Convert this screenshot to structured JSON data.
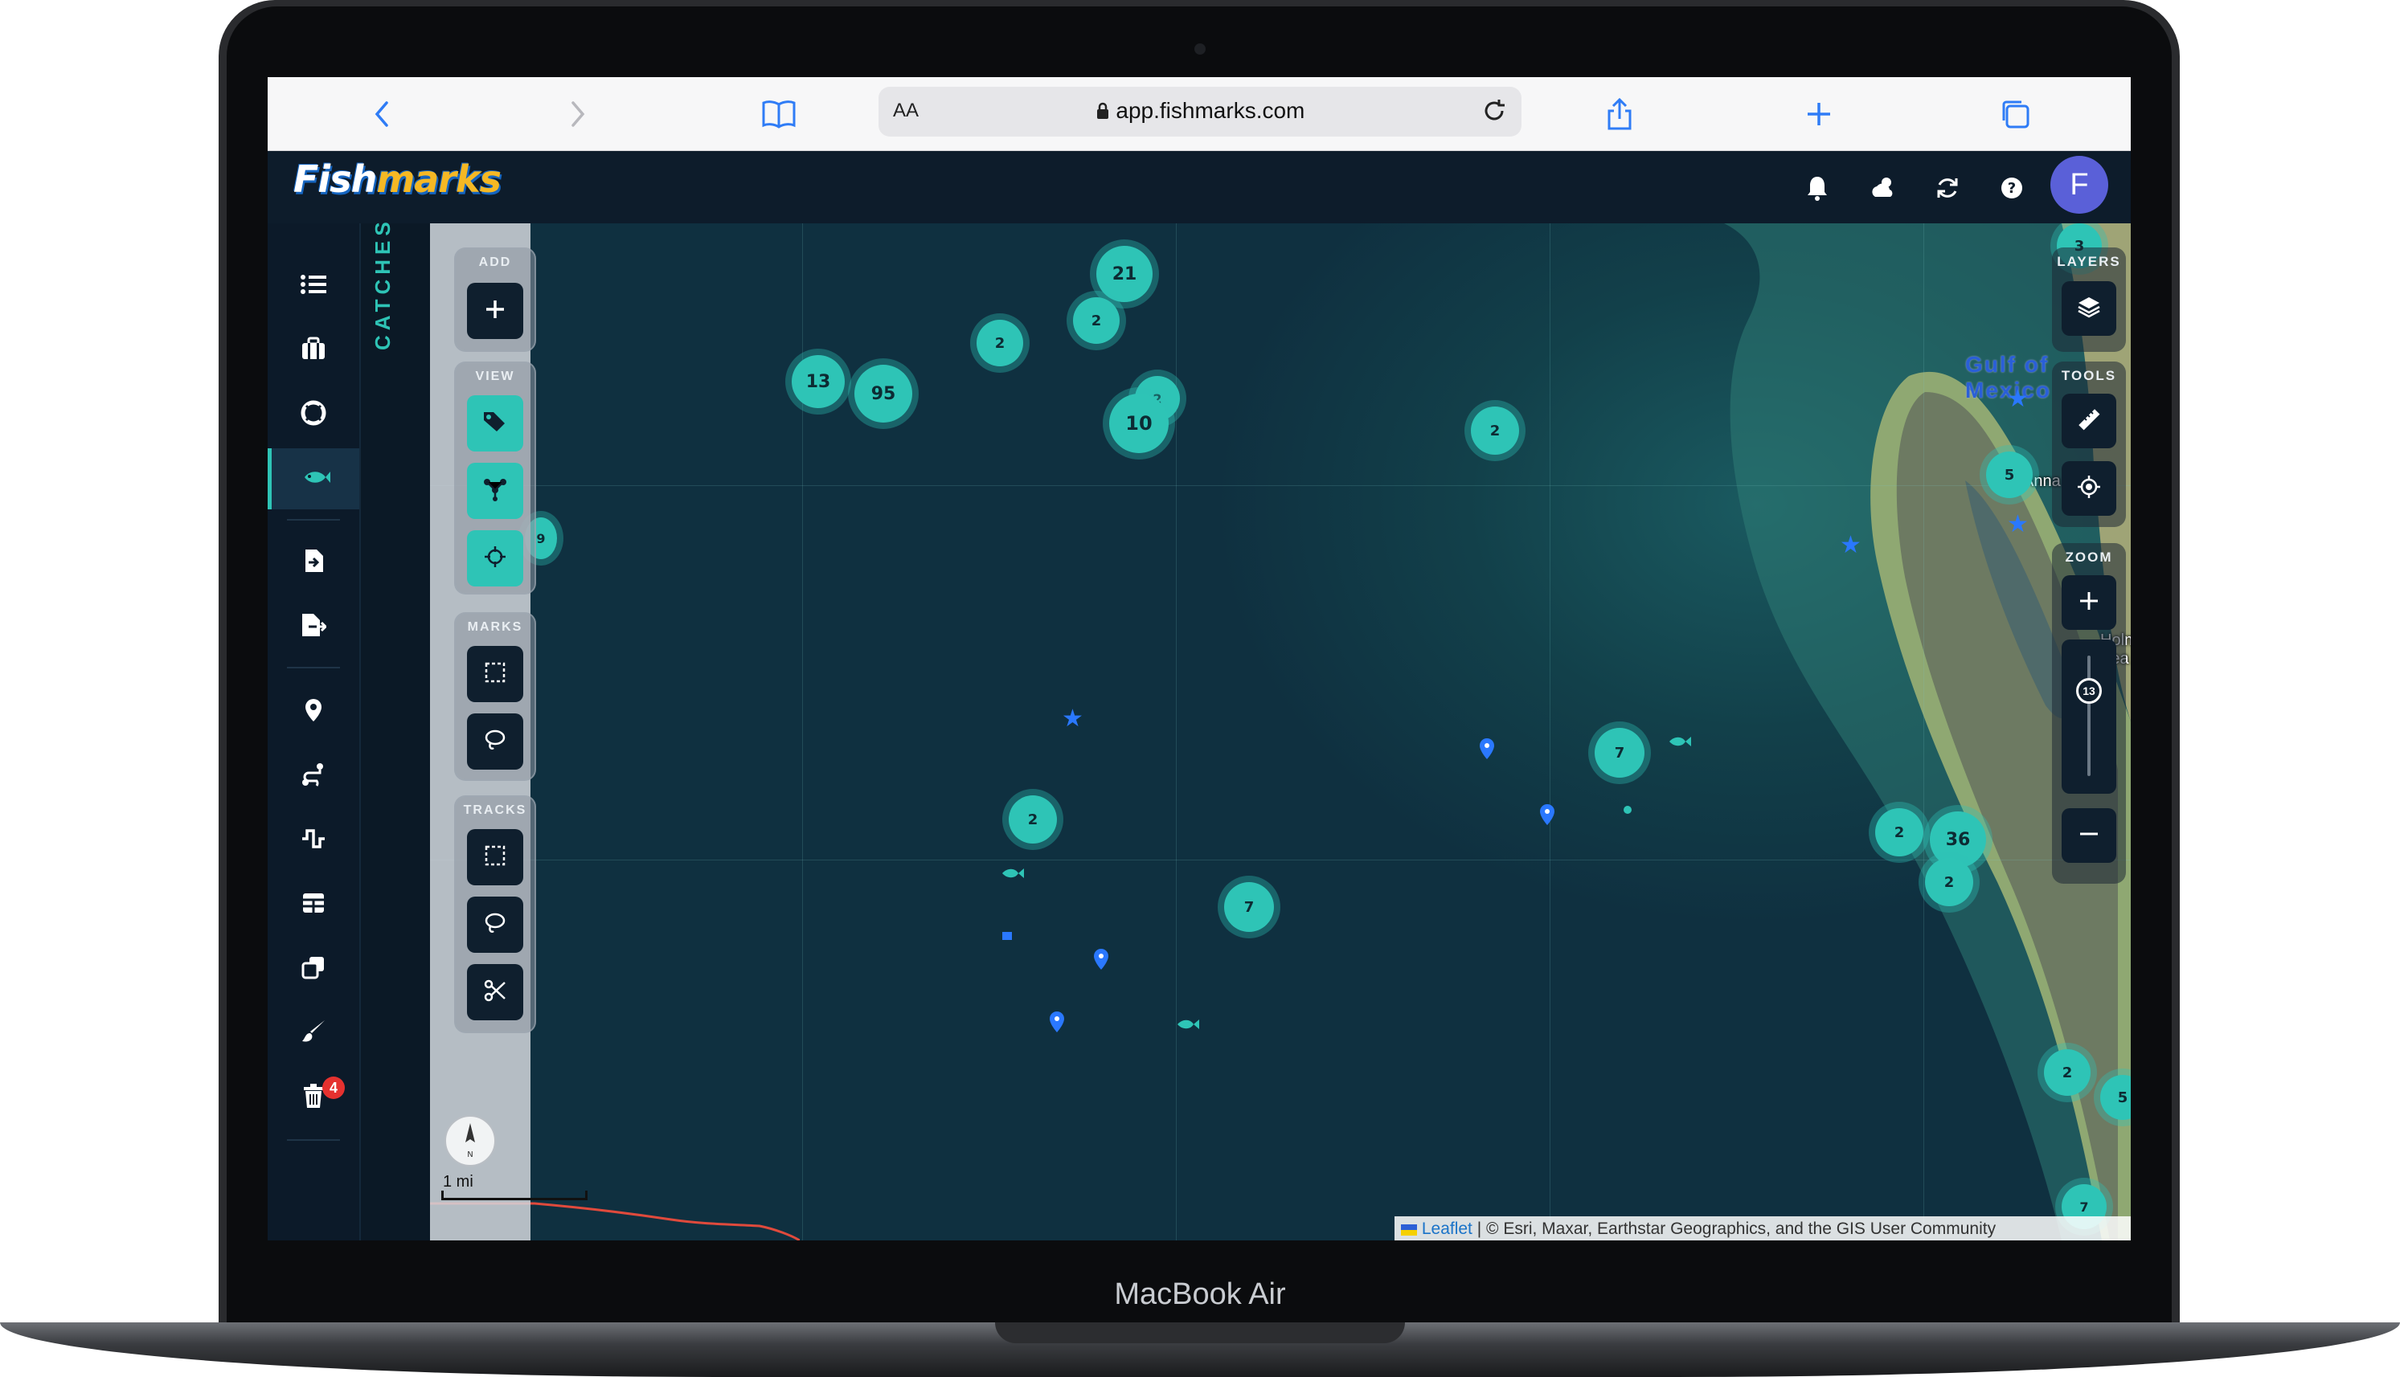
{
  "device": {
    "label": "MacBook Air"
  },
  "browser": {
    "aa_label": "AA",
    "url": "app.fishmarks.com",
    "icons": [
      "back-icon",
      "forward-icon",
      "bookmarks-icon",
      "lock-icon",
      "reload-icon",
      "share-icon",
      "new-tab-icon",
      "tabs-icon"
    ]
  },
  "app": {
    "logo_part1": "Fish",
    "logo_part2": "marks",
    "avatar_initial": "F",
    "header_icons": [
      "bell-icon",
      "weather-icon",
      "sync-icon",
      "help-icon"
    ]
  },
  "sidebar": {
    "panel_title": "CATCHES",
    "items": [
      {
        "name": "list-icon"
      },
      {
        "name": "tackle-icon"
      },
      {
        "name": "lifebuoy-icon"
      },
      {
        "name": "fish-icon",
        "active": true
      },
      {
        "name": "import-icon"
      },
      {
        "name": "export-icon"
      },
      {
        "name": "location-pin-icon"
      },
      {
        "name": "route-icon"
      },
      {
        "name": "graph-icon"
      },
      {
        "name": "table-icon"
      },
      {
        "name": "copy-icon"
      },
      {
        "name": "brush-icon"
      },
      {
        "name": "trash-icon",
        "badge": "4"
      }
    ]
  },
  "map_tools": {
    "add_label": "ADD",
    "view_label": "VIEW",
    "marks_label": "MARKS",
    "tracks_label": "TRACKS",
    "layers_label": "LAYERS",
    "tools_label": "TOOLS",
    "zoom_label": "ZOOM",
    "zoom_level": "13"
  },
  "map": {
    "gulf_label": "Gulf of Mexico",
    "town_labels": [
      "Anna Maria",
      "Holmes Bea"
    ],
    "clusters": [
      "21",
      "2",
      "2",
      "13",
      "95",
      "10",
      "2",
      "2",
      "2",
      "7",
      "7",
      "2",
      "36",
      "2",
      "5",
      "3",
      "2",
      "5",
      "7",
      "9"
    ],
    "scale_label": "1 mi",
    "attribution_link": "Leaflet",
    "attribution_text": "| © Esri, Maxar, Earthstar Geographics, and the GIS User Community"
  },
  "colors": {
    "accent": "#2ec4b6",
    "header_bg": "#0d1c2b",
    "badge": "#e5312f",
    "avatar": "#5a60d8",
    "marker_blue": "#2a78ff"
  }
}
